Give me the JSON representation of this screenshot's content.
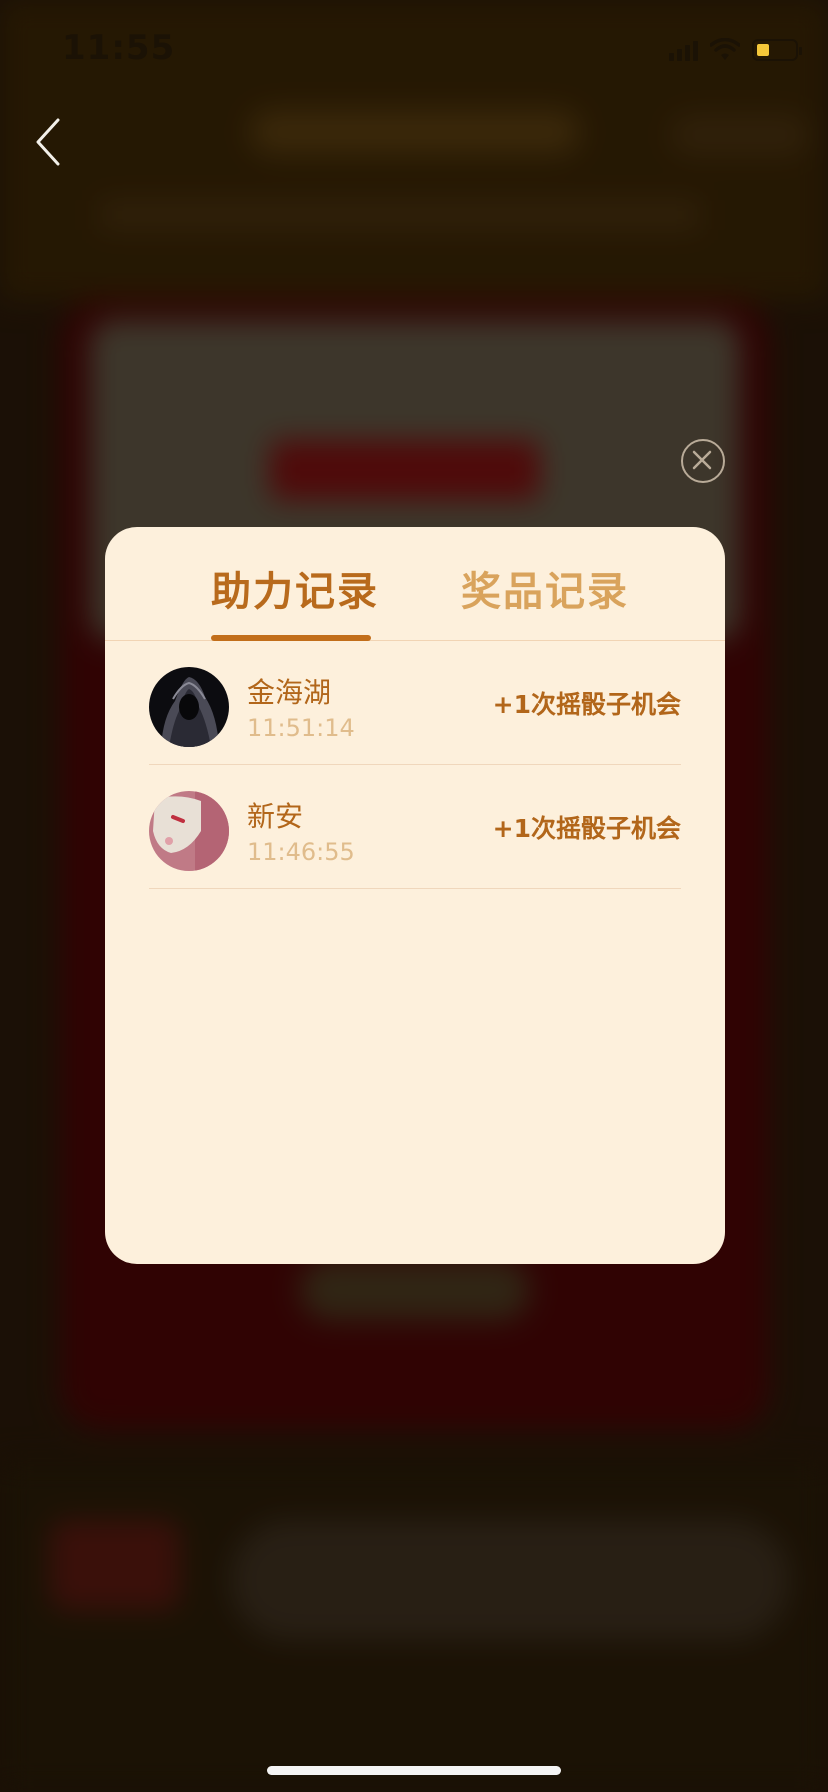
{
  "status_bar": {
    "time": "11:55"
  },
  "modal": {
    "tabs": [
      {
        "label": "助力记录",
        "active": true
      },
      {
        "label": "奖品记录",
        "active": false
      }
    ],
    "records": [
      {
        "name": "金海湖",
        "time": "11:51:14",
        "reward": "+1次摇骰子机会",
        "avatar": "hooded-figure-avatar"
      },
      {
        "name": "新安",
        "time": "11:46:55",
        "reward": "+1次摇骰子机会",
        "avatar": "pink-cartoon-avatar"
      }
    ]
  },
  "colors": {
    "modal_bg": "#fdf0dc",
    "accent": "#b86a1c",
    "tab_inactive": "#d9a35c",
    "time_text": "#e0bc8c"
  }
}
